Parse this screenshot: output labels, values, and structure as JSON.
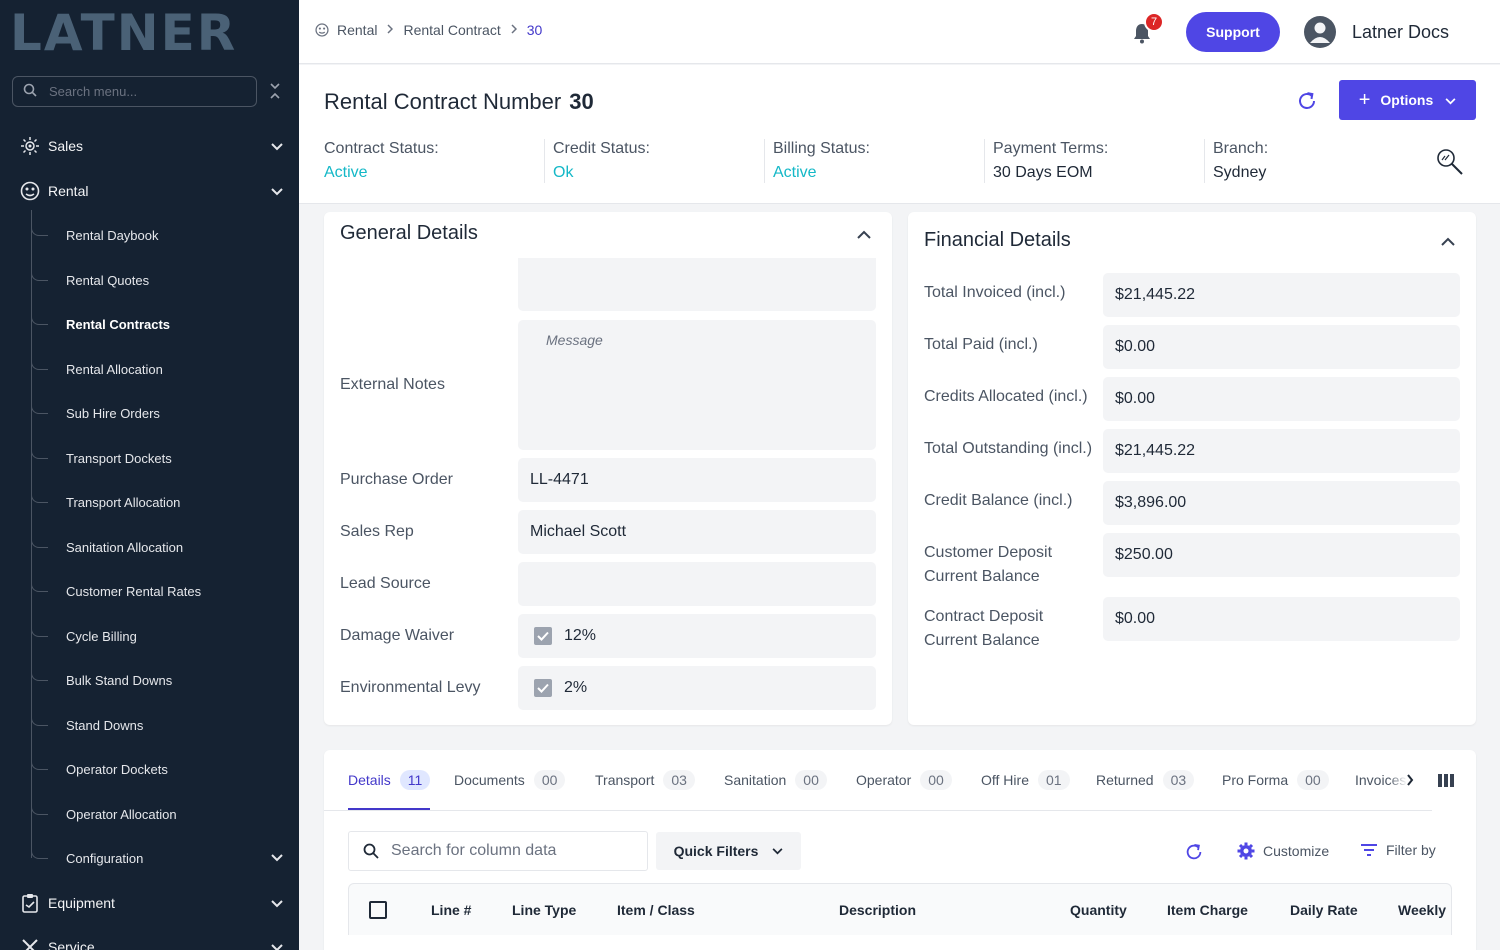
{
  "sidebar": {
    "logo": "LATNER",
    "search_placeholder": "Search menu...",
    "groups": {
      "sales": "Sales",
      "rental": "Rental",
      "equipment": "Equipment",
      "service": "Service"
    },
    "rental_items": [
      "Rental Daybook",
      "Rental Quotes",
      "Rental Contracts",
      "Rental Allocation",
      "Sub Hire Orders",
      "Transport Dockets",
      "Transport Allocation",
      "Sanitation Allocation",
      "Customer Rental Rates",
      "Cycle Billing",
      "Bulk Stand Downs",
      "Stand Downs",
      "Operator Dockets",
      "Operator Allocation",
      "Configuration"
    ],
    "active_item": "Rental Contracts"
  },
  "topbar": {
    "breadcrumb": [
      "Rental",
      "Rental Contract",
      "30"
    ],
    "notifications": "7",
    "support_label": "Support",
    "user_name": "Latner Docs"
  },
  "header": {
    "title": "Rental Contract Number",
    "number": "30",
    "options_label": "Options",
    "stats": [
      {
        "label": "Contract Status:",
        "value": "Active"
      },
      {
        "label": "Credit Status:",
        "value": "Ok"
      },
      {
        "label": "Billing Status:",
        "value": "Active"
      },
      {
        "label": "Payment Terms:",
        "value": "30 Days EOM"
      },
      {
        "label": "Branch:",
        "value": "Sydney"
      }
    ],
    "status_color": "#14b8c7",
    "accent": "#4f46e5"
  },
  "general": {
    "title": "General Details",
    "external_notes_label": "External Notes",
    "message_placeholder": "Message",
    "purchase_order_label": "Purchase Order",
    "purchase_order": "LL-4471",
    "sales_rep_label": "Sales Rep",
    "sales_rep": "Michael Scott",
    "lead_source_label": "Lead Source",
    "lead_source": "",
    "damage_waiver_label": "Damage Waiver",
    "damage_waiver": "12%",
    "env_levy_label": "Environmental Levy",
    "env_levy": "2%"
  },
  "financial": {
    "title": "Financial Details",
    "rows": [
      {
        "label": "Total Invoiced (incl.)",
        "value": "$21,445.22"
      },
      {
        "label": "Total Paid (incl.)",
        "value": "$0.00"
      },
      {
        "label": "Credits Allocated (incl.)",
        "value": "$0.00"
      },
      {
        "label": "Total Outstanding (incl.)",
        "value": "$21,445.22"
      },
      {
        "label": "Credit Balance (incl.)",
        "value": "$3,896.00"
      },
      {
        "label1": "Customer Deposit",
        "label2": "Current Balance",
        "value": "$250.00"
      },
      {
        "label1": "Contract Deposit",
        "label2": "Current Balance",
        "value": "$0.00"
      }
    ]
  },
  "tabs": [
    {
      "label": "Details",
      "count": "11"
    },
    {
      "label": "Documents",
      "count": "00"
    },
    {
      "label": "Transport",
      "count": "03"
    },
    {
      "label": "Sanitation",
      "count": "00"
    },
    {
      "label": "Operator",
      "count": "00"
    },
    {
      "label": "Off Hire",
      "count": "01"
    },
    {
      "label": "Returned",
      "count": "03"
    },
    {
      "label": "Pro Forma",
      "count": "00"
    },
    {
      "label": "Invoices",
      "count": ""
    }
  ],
  "grid": {
    "search_placeholder": "Search for column data",
    "quick_filters": "Quick Filters",
    "customize": "Customize",
    "filter_by": "Filter by",
    "columns": [
      "Line #",
      "Line Type",
      "Item / Class",
      "Description",
      "Quantity",
      "Item Charge",
      "Daily Rate",
      "Weekly"
    ]
  }
}
